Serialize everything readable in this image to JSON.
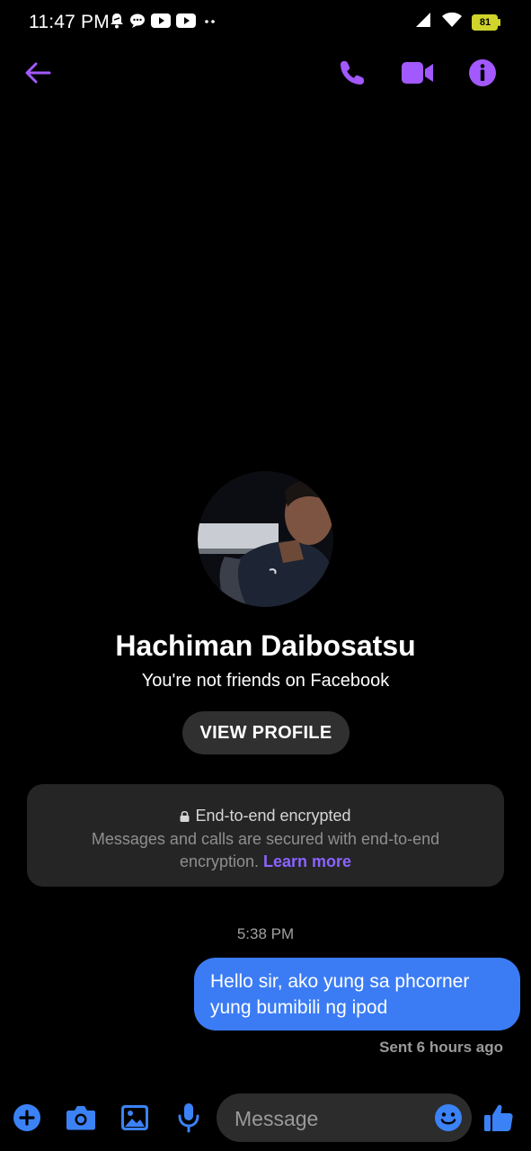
{
  "status": {
    "time": "11:47 PM",
    "battery": "81"
  },
  "contact": {
    "name": "Hachiman Daibosatsu",
    "relationship": "You're not friends on Facebook",
    "view_profile_label": "VIEW PROFILE"
  },
  "encryption": {
    "title": "End-to-end encrypted",
    "body": "Messages and calls are secured with end-to-end encryption.",
    "learn_more": "Learn more"
  },
  "conversation": {
    "timestamp": "5:38 PM",
    "messages": [
      {
        "text": "Hello sir, ako yung sa phcorner yung bumibili ng ipod",
        "from": "me"
      }
    ],
    "receipt": "Sent 6 hours ago"
  },
  "composer": {
    "placeholder": "Message"
  },
  "colors": {
    "accent": "#a259ff",
    "composer_blue": "#3b82f6",
    "bubble": "#3b7cf5",
    "link": "#8a63ff"
  }
}
